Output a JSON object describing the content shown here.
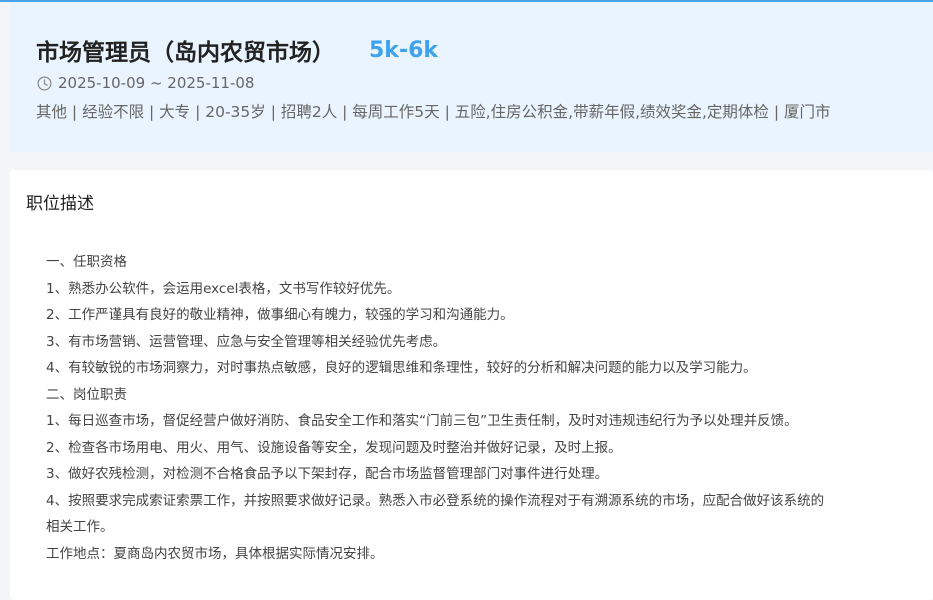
{
  "job": {
    "title": "市场管理员（岛内农贸市场）",
    "salary": "5k-6k",
    "date_range": "2025-10-09 ~ 2025-11-08",
    "tags": "其他 | 经验不限 | 大专 | 20-35岁 | 招聘2人 | 每周工作5天 | 五险,住房公积金,带薪年假,绩效奖金,定期体检 | 厦门市"
  },
  "description": {
    "section_title": "职位描述",
    "lines": [
      "一、任职资格",
      "1、熟悉办公软件，会运用excel表格，文书写作较好优先。",
      "2、工作严谨具有良好的敬业精神，做事细心有魄力，较强的学习和沟通能力。",
      "3、有市场营销、运营管理、应急与安全管理等相关经验优先考虑。",
      "4、有较敏锐的市场洞察力，对时事热点敏感，良好的逻辑思维和条理性，较好的分析和解决问题的能力以及学习能力。",
      "二、岗位职责",
      "1、每日巡查市场，督促经营户做好消防、食品安全工作和落实“门前三包”卫生责任制，及时对违规违纪行为予以处理并反馈。",
      "2、检查各市场用电、用火、用气、设施设备等安全，发现问题及时整治并做好记录，及时上报。",
      "3、做好农残检测，对检测不合格食品予以下架封存，配合市场监督管理部门对事件进行处理。",
      "4、按照要求完成索证索票工作，并按照要求做好记录。熟悉入市必登系统的操作流程对于有溯源系统的市场，应配合做好该系统的",
      "相关工作。",
      "工作地点：夏商岛内农贸市场，具体根据实际情况安排。"
    ]
  },
  "icons": {
    "date": "clock-icon"
  },
  "colors": {
    "accent": "#3fa2ec",
    "header_bg": "#e9f4fe",
    "top_border": "#4aa3f0"
  }
}
